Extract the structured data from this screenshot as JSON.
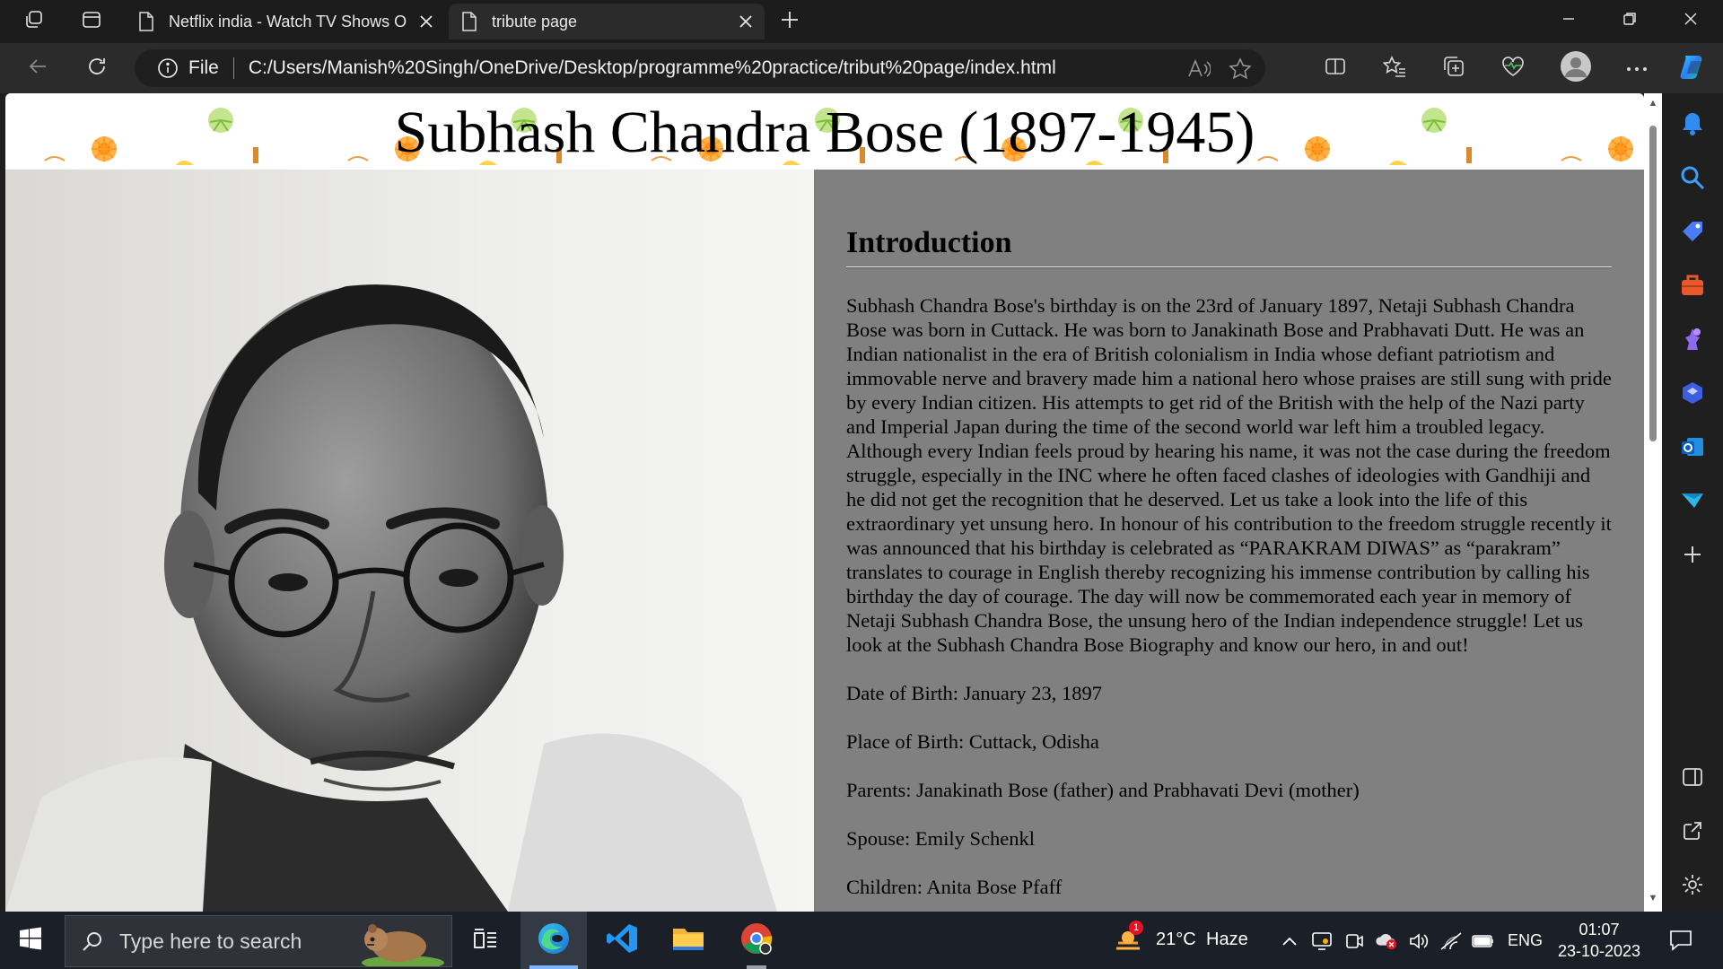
{
  "browser": {
    "tabs": [
      {
        "title": "Netflix india - Watch TV Shows O",
        "active": false
      },
      {
        "title": "tribute page",
        "active": true
      }
    ],
    "address": {
      "scheme_label": "File",
      "url": "C:/Users/Manish%20Singh/OneDrive/Desktop/programme%20practice/tribut%20page/index.html"
    }
  },
  "page": {
    "title": "Subhash Chandra Bose (1897-1945)",
    "portrait_alt": "Portrait of Subhash Chandra Bose",
    "section_heading": "Introduction",
    "intro": "Subhash Chandra Bose's birthday is on the 23rd of January 1897, Netaji Subhash Chandra Bose was born in Cuttack. He was born to Janakinath Bose and Prabhavati Dutt. He was an Indian nationalist in the era of British colonialism in India whose defiant patriotism and immovable nerve and bravery made him a national hero whose praises are still sung with pride by every Indian citizen. His attempts to get rid of the British with the help of the Nazi party and Imperial Japan during the time of the second world war left him a troubled legacy. Although every Indian feels proud by hearing his name, it was not the case during the freedom struggle, especially in the INC where he often faced clashes of ideologies with Gandhiji and he did not get the recognition that he deserved. Let us take a look into the life of this extraordinary yet unsung hero. In honour of his contribution to the freedom struggle recently it was announced that his birthday is celebrated as “PARAKRAM DIWAS” as “parakram” translates to courage in English thereby recognizing his immense contribution by calling his birthday the day of courage. The day will now be commemorated each year in memory of Netaji Subhash Chandra Bose, the unsung hero of the Indian independence struggle! Let us look at the Subhash Chandra Bose Biography and know our hero, in and out!",
    "facts": [
      "Date of Birth: January 23, 1897",
      "Place of Birth: Cuttack, Odisha",
      "Parents: Janakinath Bose (father) and Prabhavati Devi (mother)",
      "Spouse: Emily Schenkl",
      "Children: Anita Bose Pfaff"
    ],
    "content_bg": "#808080"
  },
  "taskbar": {
    "search_placeholder": "Type here to search",
    "weather": {
      "temp": "21°C",
      "condition": "Haze",
      "badge": "1"
    },
    "language": "ENG",
    "time": "01:07",
    "date": "23-10-2023"
  }
}
